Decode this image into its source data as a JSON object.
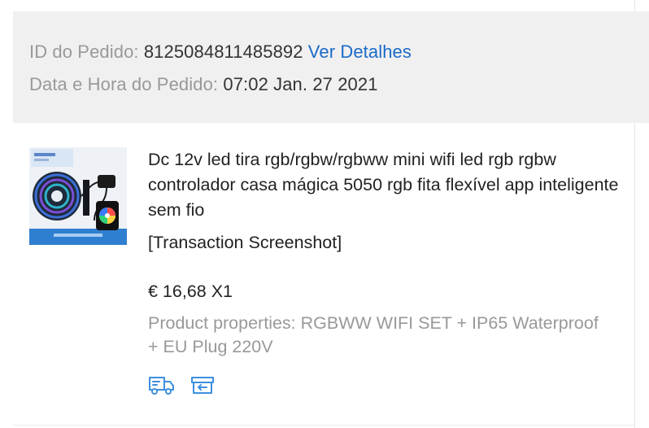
{
  "order": {
    "id_label": "ID do Pedido:",
    "id_value": "8125084811485892",
    "details_link": "Ver Detalhes",
    "datetime_label": "Data e Hora do Pedido:",
    "datetime_value": "07:02 Jan. 27 2021"
  },
  "product": {
    "title": "Dc 12v led tira rgb/rgbw/rgbww mini wifi led rgb rgbw controlador casa mágica 5050 rgb fita flexível app inteligente sem fio",
    "transaction_screenshot": "[Transaction Screenshot]",
    "price": "€ 16,68",
    "quantity": "X1",
    "properties": "Product properties: RGBWW WIFI SET + IP65 Waterproof + EU Plug 220V",
    "thumbnail_icon": "led-strip-kit-image"
  },
  "actions": {
    "icons": [
      "delivery-truck-icon",
      "return-box-icon"
    ]
  },
  "colors": {
    "header_bg": "#f0f0f0",
    "link": "#1a6ac9",
    "label_gray": "#999999",
    "text_dark": "#222222",
    "icon_blue": "#3d8fe0"
  }
}
